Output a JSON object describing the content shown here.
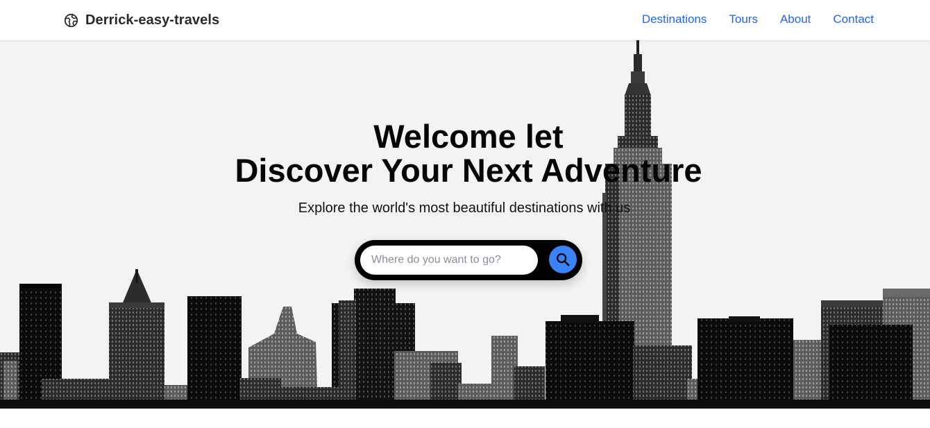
{
  "header": {
    "brand": {
      "name": "Derrick-easy-travels",
      "icon": "globe-icon"
    },
    "nav": [
      {
        "label": "Destinations"
      },
      {
        "label": "Tours"
      },
      {
        "label": "About"
      },
      {
        "label": "Contact"
      }
    ]
  },
  "hero": {
    "title_line1": "Welcome let",
    "title_line2": "Discover Your Next Adventure",
    "subtitle": "Explore the world's most beautiful destinations with us",
    "background": "city-skyline-image",
    "search": {
      "placeholder": "Where do you want to go?",
      "value": "",
      "button_icon": "search-icon"
    }
  },
  "colors": {
    "accent": "#3b82f6",
    "nav_link": "#2563eb",
    "hero_bg": "#f2f3f5",
    "search_frame": "#000000"
  }
}
